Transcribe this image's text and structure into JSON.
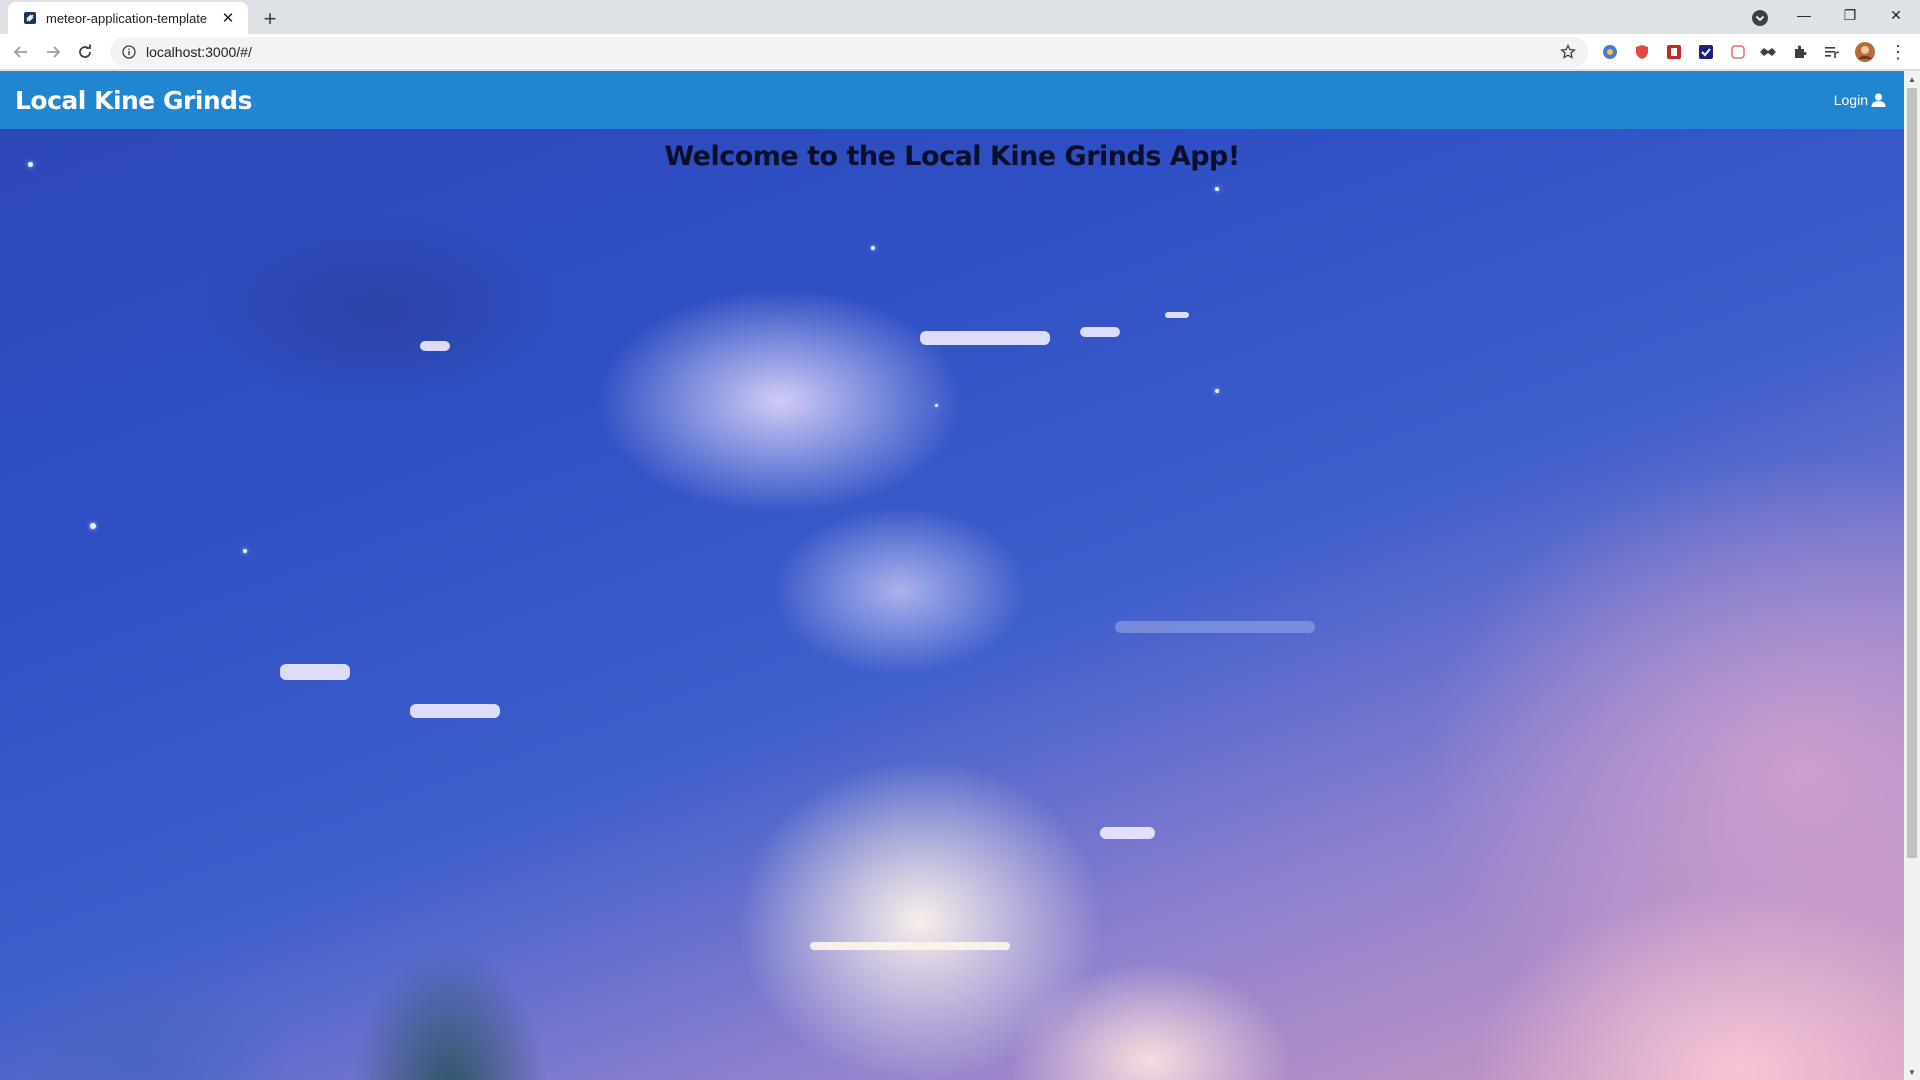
{
  "browser": {
    "tab_title": "meteor-application-template",
    "url": "localhost:3000/#/",
    "icons": {
      "tab_favicon": "meteor-favicon-icon",
      "tab_close": "close-icon",
      "new_tab": "plus-icon",
      "back": "arrow-left-icon",
      "forward": "arrow-right-icon",
      "reload": "reload-icon",
      "site_info": "info-icon",
      "bookmark": "star-icon",
      "extensions": "puzzle-icon",
      "media": "media-queue-icon",
      "profile": "avatar-icon",
      "menu": "kebab-menu-icon"
    },
    "glyphs": {
      "tab_close": "✕",
      "new_tab": "+",
      "minimize": "—",
      "restore": "❐",
      "close": "✕",
      "kebab": "⋮"
    }
  },
  "navbar": {
    "brand": "Local Kine Grinds",
    "login_label": "Login",
    "login_icon": "user-icon",
    "color": "#2185d0"
  },
  "main": {
    "welcome": "Welcome to the Local Kine Grinds App!"
  },
  "scrollbar": {
    "up_glyph": "▲",
    "down_glyph": "▼",
    "position_percent": 0
  }
}
